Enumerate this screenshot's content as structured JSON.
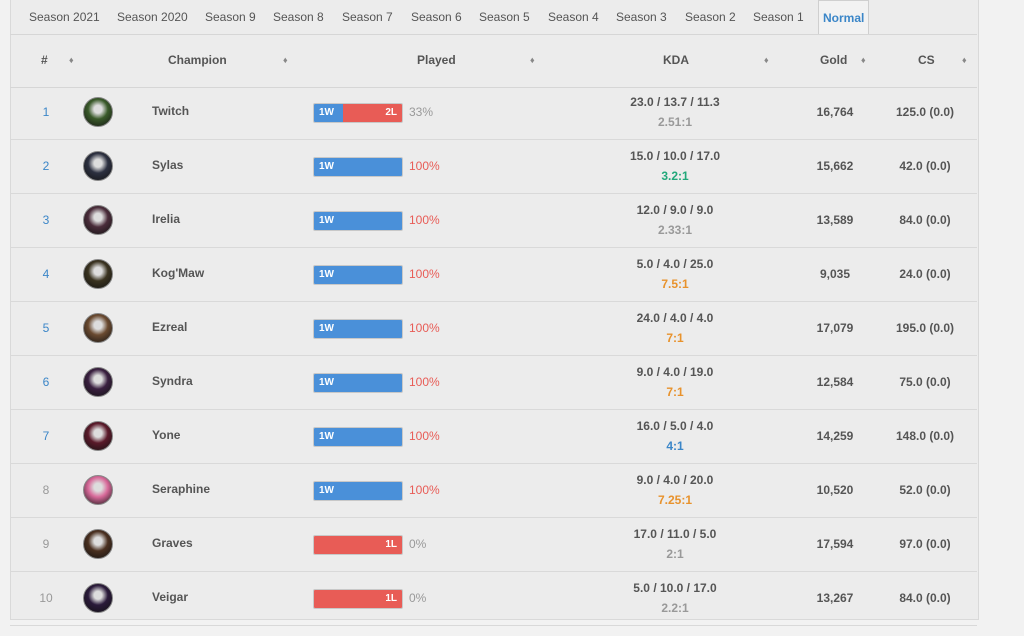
{
  "tabs": [
    {
      "label": "Season 2021"
    },
    {
      "label": "Season 2020"
    },
    {
      "label": "Season 9"
    },
    {
      "label": "Season 8"
    },
    {
      "label": "Season 7"
    },
    {
      "label": "Season 6"
    },
    {
      "label": "Season 5"
    },
    {
      "label": "Season 4"
    },
    {
      "label": "Season 3"
    },
    {
      "label": "Season 2"
    },
    {
      "label": "Season 1"
    },
    {
      "label": "Normal"
    }
  ],
  "active_tab": "Normal",
  "columns": {
    "rank": "#",
    "champion": "Champion",
    "played": "Played",
    "kda": "KDA",
    "gold": "Gold",
    "cs": "CS"
  },
  "sort_glyph": "♦",
  "colors": {
    "win": "#4a90d9",
    "loss": "#e85c56",
    "link": "#3b86c8",
    "kda_gray": "#999999",
    "kda_green": "#21a87a",
    "kda_blue": "#3b86c8",
    "kda_orange": "#e8922c"
  },
  "rows": [
    {
      "rank": "1",
      "champion": "Twitch",
      "wins": "1W",
      "losses": "2L",
      "win_ratio": 0.333,
      "pct": "33%",
      "kda_line": "23.0 / 13.7 / 11.3",
      "kda_ratio": "2.51:1",
      "kda_color": "#999999",
      "gold": "16,764",
      "cs": "125.0 (0.0)",
      "avatar_color": "#3a5a2a"
    },
    {
      "rank": "2",
      "champion": "Sylas",
      "wins": "1W",
      "losses": "",
      "win_ratio": 1,
      "pct": "100%",
      "kda_line": "15.0 / 10.0 / 17.0",
      "kda_ratio": "3.2:1",
      "kda_color": "#21a87a",
      "gold": "15,662",
      "cs": "42.0 (0.0)",
      "avatar_color": "#2c3040"
    },
    {
      "rank": "3",
      "champion": "Irelia",
      "wins": "1W",
      "losses": "",
      "win_ratio": 1,
      "pct": "100%",
      "kda_line": "12.0 / 9.0 / 9.0",
      "kda_ratio": "2.33:1",
      "kda_color": "#999999",
      "gold": "13,589",
      "cs": "84.0 (0.0)",
      "avatar_color": "#4a2c3a"
    },
    {
      "rank": "4",
      "champion": "Kog'Maw",
      "wins": "1W",
      "losses": "",
      "win_ratio": 1,
      "pct": "100%",
      "kda_line": "5.0 / 4.0 / 25.0",
      "kda_ratio": "7.5:1",
      "kda_color": "#e8922c",
      "gold": "9,035",
      "cs": "24.0 (0.0)",
      "avatar_color": "#3a3320"
    },
    {
      "rank": "5",
      "champion": "Ezreal",
      "wins": "1W",
      "losses": "",
      "win_ratio": 1,
      "pct": "100%",
      "kda_line": "24.0 / 4.0 / 4.0",
      "kda_ratio": "7:1",
      "kda_color": "#e8922c",
      "gold": "17,079",
      "cs": "195.0 (0.0)",
      "avatar_color": "#6a4a30"
    },
    {
      "rank": "6",
      "champion": "Syndra",
      "wins": "1W",
      "losses": "",
      "win_ratio": 1,
      "pct": "100%",
      "kda_line": "9.0 / 4.0 / 19.0",
      "kda_ratio": "7:1",
      "kda_color": "#e8922c",
      "gold": "12,584",
      "cs": "75.0 (0.0)",
      "avatar_color": "#3a2040"
    },
    {
      "rank": "7",
      "champion": "Yone",
      "wins": "1W",
      "losses": "",
      "win_ratio": 1,
      "pct": "100%",
      "kda_line": "16.0 / 5.0 / 4.0",
      "kda_ratio": "4:1",
      "kda_color": "#3b86c8",
      "gold": "14,259",
      "cs": "148.0 (0.0)",
      "avatar_color": "#5a1a2a"
    },
    {
      "rank": "8",
      "champion": "Seraphine",
      "wins": "1W",
      "losses": "",
      "win_ratio": 1,
      "pct": "100%",
      "kda_line": "9.0 / 4.0 / 20.0",
      "kda_ratio": "7.25:1",
      "kda_color": "#e8922c",
      "gold": "10,520",
      "cs": "52.0 (0.0)",
      "avatar_color": "#d86a9a"
    },
    {
      "rank": "9",
      "champion": "Graves",
      "wins": "",
      "losses": "1L",
      "win_ratio": 0,
      "pct": "0%",
      "kda_line": "17.0 / 11.0 / 5.0",
      "kda_ratio": "2:1",
      "kda_color": "#999999",
      "gold": "17,594",
      "cs": "97.0 (0.0)",
      "avatar_color": "#4a3020"
    },
    {
      "rank": "10",
      "champion": "Veigar",
      "wins": "",
      "losses": "1L",
      "win_ratio": 0,
      "pct": "0%",
      "kda_line": "5.0 / 10.0 / 17.0",
      "kda_ratio": "2.2:1",
      "kda_color": "#999999",
      "gold": "13,267",
      "cs": "84.0 (0.0)",
      "avatar_color": "#2a1a3a"
    }
  ]
}
